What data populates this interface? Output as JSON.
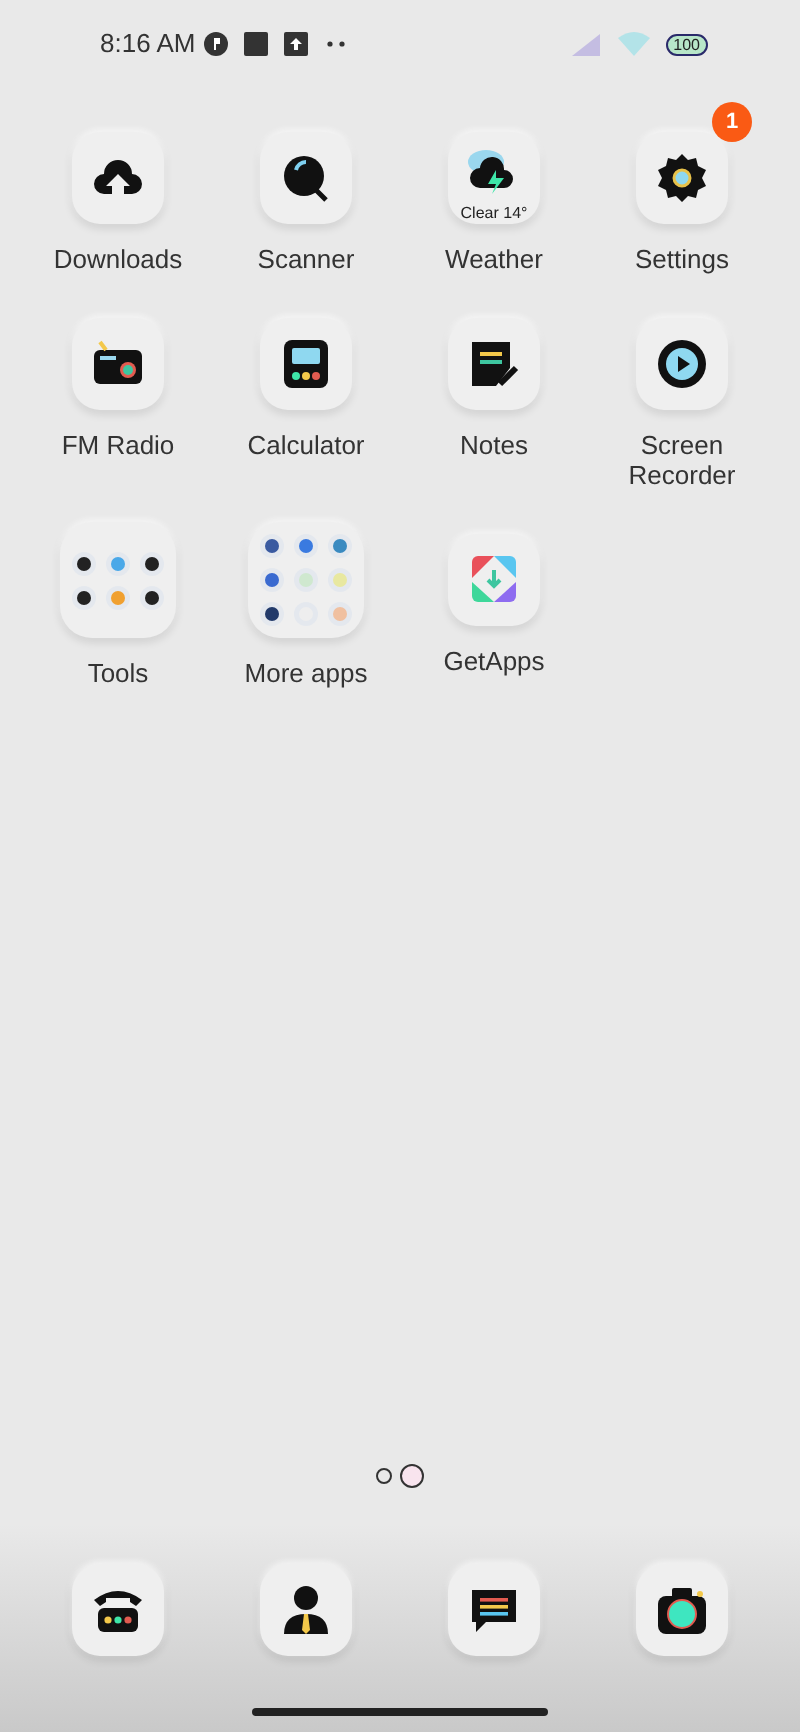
{
  "status_bar": {
    "time": "8:16 AM",
    "battery": "100"
  },
  "apps": [
    {
      "kind": "app",
      "label": "Downloads"
    },
    {
      "kind": "app",
      "label": "Scanner"
    },
    {
      "kind": "weather",
      "label": "Weather",
      "caption": "Clear 14°"
    },
    {
      "kind": "app",
      "label": "Settings",
      "badge": "1"
    },
    {
      "kind": "app",
      "label": "FM Radio"
    },
    {
      "kind": "app",
      "label": "Calculator"
    },
    {
      "kind": "app",
      "label": "Notes"
    },
    {
      "kind": "app",
      "label": "Screen Recorder"
    },
    {
      "kind": "folder",
      "label": "Tools"
    },
    {
      "kind": "folder",
      "label": "More apps"
    },
    {
      "kind": "app",
      "label": "GetApps"
    }
  ],
  "pages": [
    {
      "selected": false
    },
    {
      "selected": true
    }
  ],
  "dock": [
    {
      "kind": "app"
    },
    {
      "kind": "app"
    },
    {
      "kind": "app"
    },
    {
      "kind": "app"
    }
  ]
}
